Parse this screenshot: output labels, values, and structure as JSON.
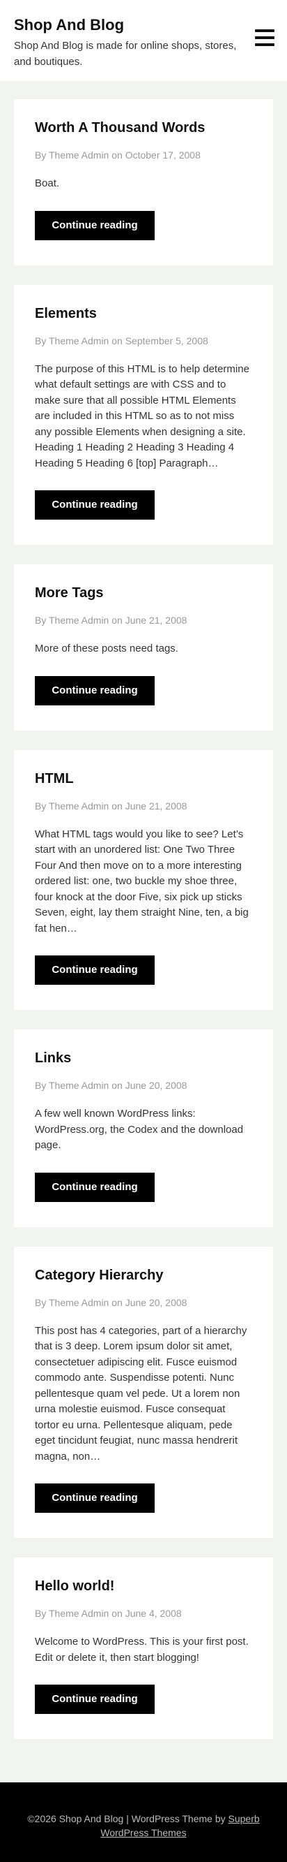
{
  "header": {
    "site_title": "Shop And Blog",
    "site_description": "Shop And Blog is made for online shops, stores, and boutiques."
  },
  "posts": [
    {
      "title": "Worth A Thousand Words",
      "meta": "By Theme Admin on October 17, 2008",
      "excerpt": "Boat.",
      "button": "Continue reading"
    },
    {
      "title": "Elements",
      "meta": "By Theme Admin on September 5, 2008",
      "excerpt": "The purpose of this HTML is to help determine what default settings are with CSS and to make sure that all possible HTML Elements are included in this HTML so as to not miss any possible Elements when designing a site. Heading 1 Heading 2 Heading 3 Heading 4 Heading 5 Heading 6 [top] Paragraph…",
      "button": "Continue reading"
    },
    {
      "title": "More Tags",
      "meta": "By Theme Admin on June 21, 2008",
      "excerpt": "More of these posts need tags.",
      "button": "Continue reading"
    },
    {
      "title": "HTML",
      "meta": "By Theme Admin on June 21, 2008",
      "excerpt": "What HTML tags would you like to see? Let’s start with an unordered list: One Two Three Four And then move on to a more interesting ordered list: one, two buckle my shoe three, four knock at the door Five, six pick up sticks Seven, eight, lay them straight Nine, ten, a big fat hen…",
      "button": "Continue reading"
    },
    {
      "title": "Links",
      "meta": "By Theme Admin on June 20, 2008",
      "excerpt": "A few well known WordPress links: WordPress.org, the Codex and the download page.",
      "button": "Continue reading"
    },
    {
      "title": "Category Hierarchy",
      "meta": "By Theme Admin on June 20, 2008",
      "excerpt": "This post has 4 categories, part of a hierarchy that is 3 deep. Lorem ipsum dolor sit amet, consectetuer adipiscing elit. Fusce euismod commodo ante. Suspendisse potenti. Nunc pellentesque quam vel pede. Ut a lorem non urna molestie euismod. Fusce consequat tortor eu urna. Pellentesque aliquam, pede eget tincidunt feugiat, nunc massa hendrerit magna, non…",
      "button": "Continue reading"
    },
    {
      "title": "Hello world!",
      "meta": "By Theme Admin on June 4, 2008",
      "excerpt": "Welcome to WordPress. This is your first post. Edit or delete it, then start blogging!",
      "button": "Continue reading"
    }
  ],
  "footer": {
    "text": "©2026 Shop And Blog | WordPress Theme by ",
    "link_label": "Superb WordPress Themes"
  }
}
